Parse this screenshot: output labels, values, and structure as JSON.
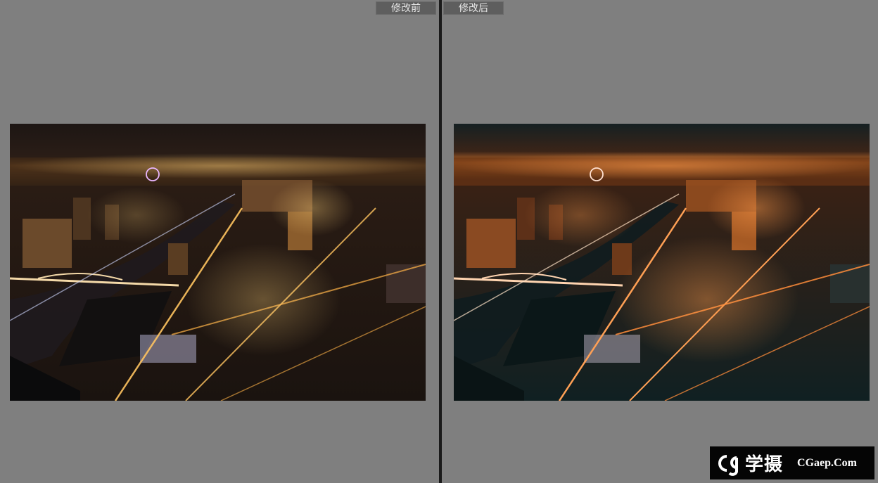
{
  "left_pane": {
    "label": "修改前"
  },
  "right_pane": {
    "label": "修改后"
  },
  "watermark": {
    "brand_cn": "学摄",
    "brand_en": "CGaep.Com",
    "logo_icon": "cg-logo-icon"
  },
  "colors": {
    "window_bg": "#7f7f7f",
    "label_bg": "#5e5e5e",
    "divider": "#1a1a1a",
    "before_glow": "#ffb347",
    "after_glow": "#ff8c3a"
  }
}
